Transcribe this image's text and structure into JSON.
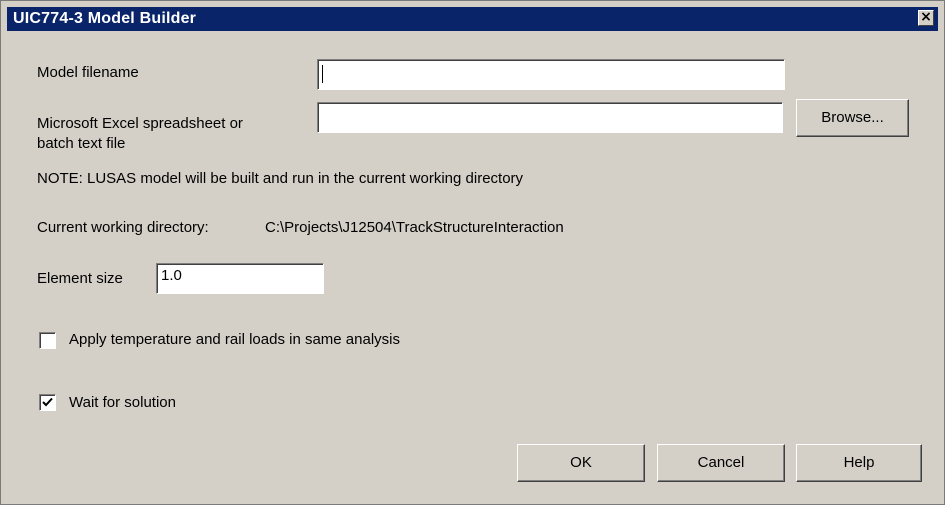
{
  "window": {
    "title": "UIC774-3 Model Builder",
    "close_glyph": "×",
    "titlebar_color": "#0a246a",
    "background_color": "#d4d0c8"
  },
  "fields": {
    "model_filename": {
      "label": "Model filename",
      "value": ""
    },
    "spreadsheet": {
      "label_line1": "Microsoft Excel spreadsheet or",
      "label_line2": "batch text file",
      "value": "",
      "browse_label": "Browse..."
    },
    "note": "NOTE: LUSAS model will be built and run in the current working directory",
    "working_dir": {
      "label": "Current working directory:",
      "value": "C:\\Projects\\J12504\\TrackStructureInteraction"
    },
    "element_size": {
      "label": "Element size",
      "value": "1.0"
    }
  },
  "options": {
    "apply_temperature": {
      "label": "Apply temperature and rail loads in same analysis",
      "checked": false
    },
    "wait_for_solution": {
      "label": "Wait for solution",
      "checked": true
    }
  },
  "buttons": {
    "ok": "OK",
    "cancel": "Cancel",
    "help": "Help"
  }
}
